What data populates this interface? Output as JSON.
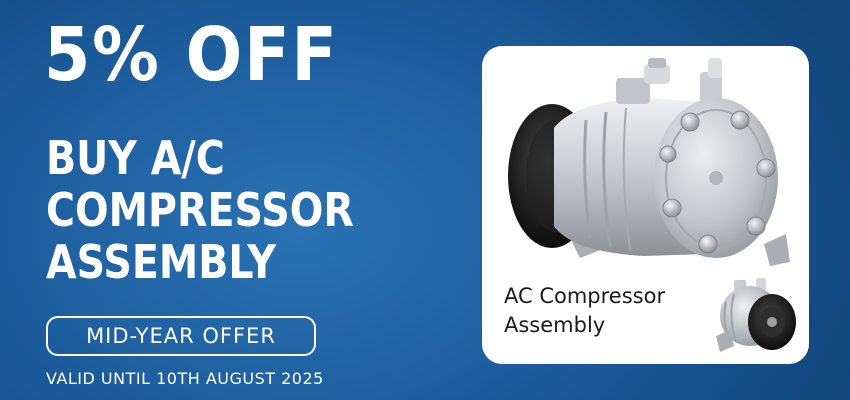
{
  "banner": {
    "headline": "5% OFF",
    "subhead_lines": [
      "BUY A/C",
      "COMPRESSOR",
      "ASSEMBLY"
    ],
    "offer_label": "MID-YEAR OFFER",
    "validity": "VALID UNTIL 10TH AUGUST 2025"
  },
  "product": {
    "caption_lines": [
      "AC Compressor",
      "Assembly"
    ],
    "main_image_icon": "ac-compressor-icon",
    "thumbnail_icon": "ac-compressor-thumbnail-icon"
  },
  "colors": {
    "background": "#1d5e9e",
    "text": "#ffffff",
    "card": "#ffffff",
    "caption": "#1b1b1b"
  }
}
